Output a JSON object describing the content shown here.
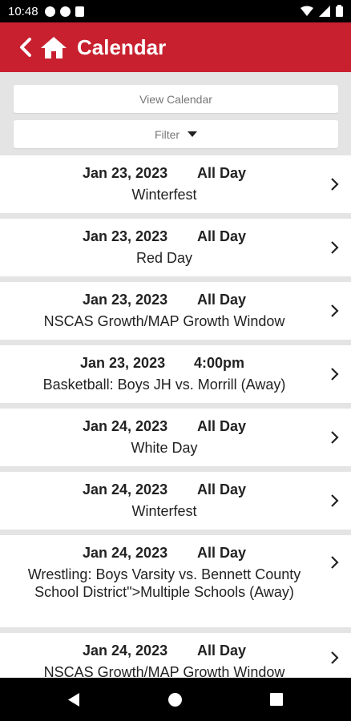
{
  "status_bar": {
    "time": "10:48"
  },
  "app_bar": {
    "title": "Calendar"
  },
  "controls": {
    "view_calendar": "View Calendar",
    "filter": "Filter"
  },
  "events": [
    {
      "date": "Jan 23, 2023",
      "time": "All Day",
      "title": "Winterfest"
    },
    {
      "date": "Jan 23, 2023",
      "time": "All Day",
      "title": "Red Day"
    },
    {
      "date": "Jan 23, 2023",
      "time": "All Day",
      "title": "NSCAS Growth/MAP Growth Window"
    },
    {
      "date": "Jan 23, 2023",
      "time": "4:00pm",
      "title": "Basketball: Boys JH vs. Morrill (Away)"
    },
    {
      "date": "Jan 24, 2023",
      "time": "All Day",
      "title": "White Day"
    },
    {
      "date": "Jan 24, 2023",
      "time": "All Day",
      "title": "Winterfest"
    },
    {
      "date": "Jan 24, 2023",
      "time": "All Day",
      "title": "Wrestling: Boys Varsity vs. Bennett County School District\">Multiple Schools (Away)"
    },
    {
      "date": "Jan 24, 2023",
      "time": "All Day",
      "title": "NSCAS Growth/MAP Growth Window"
    }
  ],
  "colors": {
    "app_bar": "#c8202f",
    "background": "#e4e4e4"
  }
}
